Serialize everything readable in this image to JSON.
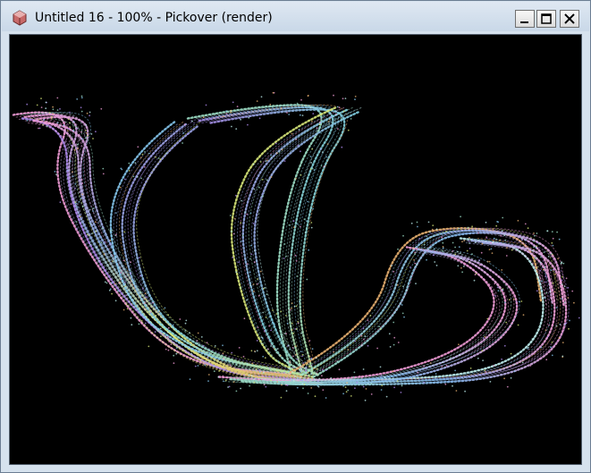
{
  "window": {
    "title": "Untitled 16 - 100% - Pickover (render)",
    "icon": "pickover-app-icon",
    "controls": {
      "minimize": "minimize-icon",
      "maximize": "maximize-icon",
      "close": "close-icon"
    }
  },
  "canvas": {
    "background": "#000000",
    "palette": [
      "#f09bd6",
      "#b08bf0",
      "#86c8f0",
      "#9ee0c8",
      "#d8e87a",
      "#e8b070",
      "#c0f0f0"
    ]
  }
}
